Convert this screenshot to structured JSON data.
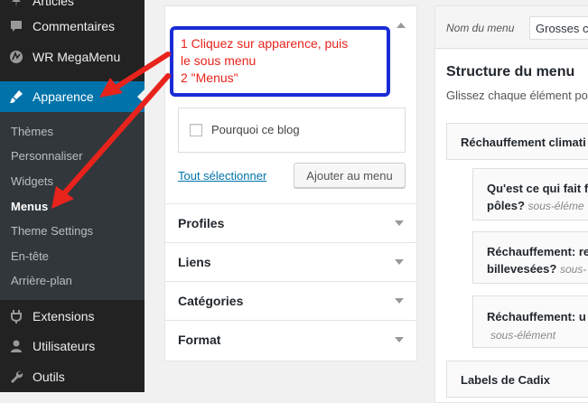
{
  "sidebar": {
    "items": [
      {
        "label": "Articles",
        "icon": "pin-icon"
      },
      {
        "label": "Commentaires",
        "icon": "comment-icon"
      },
      {
        "label": "WR MegaMenu",
        "icon": "megamenu-icon"
      },
      {
        "label": "Apparence",
        "icon": "brush-icon",
        "active": true
      },
      {
        "label": "Extensions",
        "icon": "plugin-icon"
      },
      {
        "label": "Utilisateurs",
        "icon": "user-icon"
      },
      {
        "label": "Outils",
        "icon": "wrench-icon"
      }
    ],
    "submenu": [
      "Thèmes",
      "Personnaliser",
      "Widgets",
      "Menus",
      "Theme Settings",
      "En-tête",
      "Arrière-plan"
    ],
    "current_submenu": "Menus",
    "accent_color": "#0073aa"
  },
  "left_panel": {
    "checkbox_label": "Pourquoi ce blog",
    "select_all": "Tout sélectionner",
    "add_button": "Ajouter au menu",
    "sections": [
      "Profiles",
      "Liens",
      "Catégories",
      "Format"
    ]
  },
  "editor": {
    "name_label": "Nom du menu",
    "name_value": "Grosses ce",
    "title": "Structure du menu",
    "description": "Glissez chaque élément po",
    "items": [
      {
        "title": "Réchauffement climati",
        "sub": ""
      },
      {
        "title": "Qu'est ce qui fait f",
        "title2": "pôles?",
        "sub": "sous-éléme"
      },
      {
        "title": "Réchauffement: re",
        "title2": "billevesées?",
        "sub": "sous-"
      },
      {
        "title": "Réchauffement: u",
        "title2": "",
        "sub": "sous-élément"
      },
      {
        "title": "Labels de Cadix",
        "sub": ""
      }
    ]
  },
  "annotation": {
    "lines": [
      "1 Cliquez sur apparence, puis",
      "le sous menu",
      "2 \"Menus\""
    ],
    "text_color": "#e8231c",
    "border_color": "#1a2bd6"
  }
}
